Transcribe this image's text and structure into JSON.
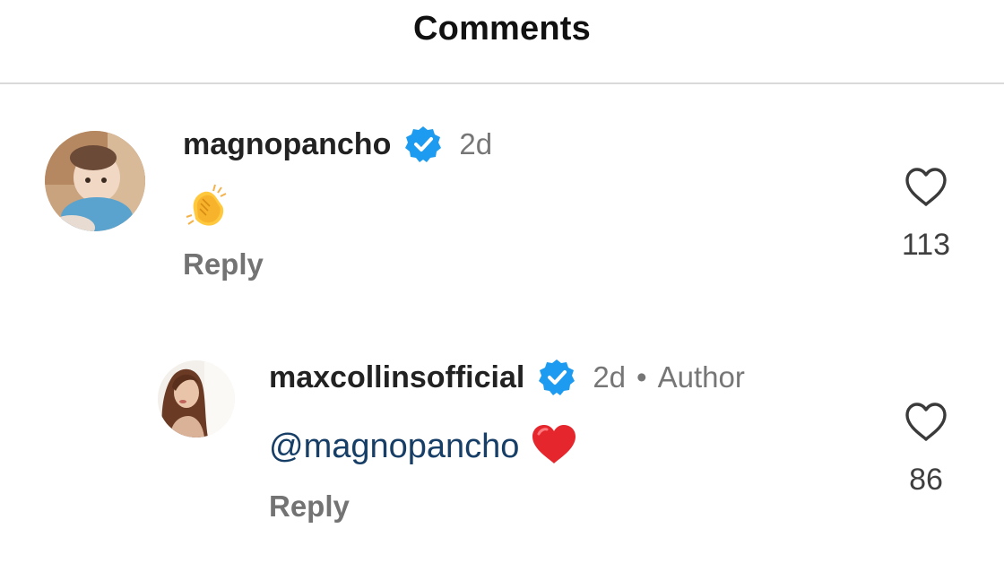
{
  "header": {
    "title": "Comments"
  },
  "comments": [
    {
      "username": "magnopancho",
      "verified": true,
      "time": "2d",
      "reaction_emoji": "clapping-hands",
      "reply_label": "Reply",
      "likes": "113"
    },
    {
      "username": "maxcollinsofficial",
      "verified": true,
      "time": "2d",
      "separator": "•",
      "badge": "Author",
      "mention": "@magnopancho",
      "reaction_emoji": "red-heart",
      "reply_label": "Reply",
      "likes": "86"
    }
  ],
  "colors": {
    "verified_blue": "#1d9bf0",
    "mention_blue": "#173e66",
    "muted_gray": "#737373",
    "heart_red": "#e6262d"
  }
}
